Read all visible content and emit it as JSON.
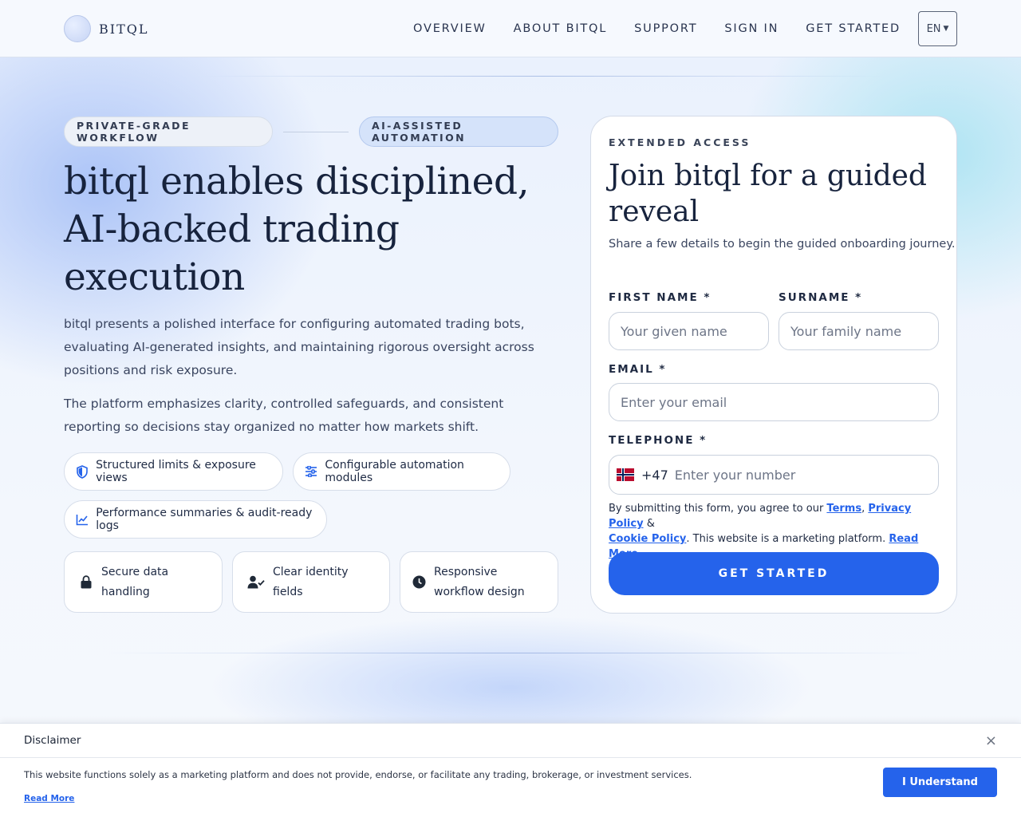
{
  "header": {
    "brand": "BITQL",
    "nav": [
      "OVERVIEW",
      "ABOUT BITQL",
      "SUPPORT",
      "SIGN IN",
      "GET STARTED"
    ],
    "language": "EN"
  },
  "hero": {
    "pill_left": "PRIVATE-GRADE WORKFLOW",
    "pill_right": "AI-ASSISTED AUTOMATION",
    "title": "bitql enables disciplined, AI-backed trading execution",
    "paragraph1": "bitql presents a polished interface for configuring automated trading bots, evaluating AI-generated insights, and maintaining rigorous oversight across positions and risk exposure.",
    "paragraph2": "The platform emphasizes clarity, controlled safeguards, and consistent reporting so decisions stay organized no matter how markets shift.",
    "features": [
      {
        "label": "Structured limits & exposure views",
        "icon": "shield-icon"
      },
      {
        "label": "Configurable automation modules",
        "icon": "sliders-icon"
      },
      {
        "label": "Performance summaries & audit-ready logs",
        "icon": "line-chart-icon"
      }
    ],
    "cards": [
      {
        "label": "Secure data handling",
        "icon": "lock-icon"
      },
      {
        "label": "Clear identity fields",
        "icon": "user-check-icon"
      },
      {
        "label": "Responsive workflow design",
        "icon": "clock-icon"
      }
    ]
  },
  "form": {
    "eyebrow": "EXTENDED ACCESS",
    "title": "Join bitql for a guided reveal",
    "subtitle": "Share a few details to begin the guided onboarding journey.",
    "first_name_label": "FIRST NAME *",
    "first_name_placeholder": "Your given name",
    "surname_label": "SURNAME *",
    "surname_placeholder": "Your family name",
    "email_label": "EMAIL *",
    "email_placeholder": "Enter your email",
    "telephone_label": "TELEPHONE *",
    "telephone_code": "+47",
    "telephone_placeholder": "Enter your number",
    "terms_prefix": "By submitting this form, you agree to our ",
    "terms_link": "Terms",
    "terms_sep1": ", ",
    "privacy_link": "Privacy Policy",
    "terms_sep2": " & ",
    "cookie_link": "Cookie Policy",
    "terms_mid": ". This website is a marketing platform. ",
    "read_more": "Read More",
    "submit": "GET STARTED"
  },
  "disclaimer": {
    "title": "Disclaimer",
    "close": "×",
    "text": "This website functions solely as a marketing platform and does not provide, endorse, or facilitate any trading, brokerage, or investment services.",
    "read_more": "Read More",
    "button": "I Understand"
  },
  "colors": {
    "accent": "#2563eb",
    "heading": "#17233d"
  }
}
